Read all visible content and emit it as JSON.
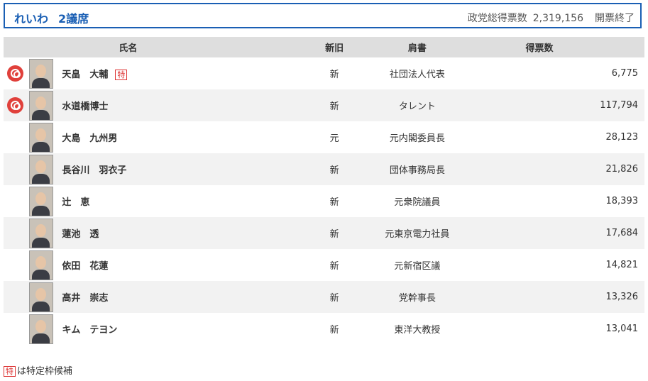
{
  "header": {
    "party": "れいわ",
    "seats": "2議席",
    "total_label": "政党総得票数",
    "total_votes": "2,319,156",
    "status": "開票終了"
  },
  "columns": {
    "name": "氏名",
    "new_old": "新旧",
    "title": "肩書",
    "votes": "得票数"
  },
  "badge_label": "特",
  "candidates": [
    {
      "name": "天畠　大輔",
      "new_old": "新",
      "title": "社団法人代表",
      "votes": "6,775",
      "elected": true,
      "special": true
    },
    {
      "name": "水道橋博士",
      "new_old": "新",
      "title": "タレント",
      "votes": "117,794",
      "elected": true,
      "special": false
    },
    {
      "name": "大島　九州男",
      "new_old": "元",
      "title": "元内閣委員長",
      "votes": "28,123",
      "elected": false,
      "special": false
    },
    {
      "name": "長谷川　羽衣子",
      "new_old": "新",
      "title": "団体事務局長",
      "votes": "21,826",
      "elected": false,
      "special": false
    },
    {
      "name": "辻　恵",
      "new_old": "新",
      "title": "元衆院議員",
      "votes": "18,393",
      "elected": false,
      "special": false
    },
    {
      "name": "蓮池　透",
      "new_old": "新",
      "title": "元東京電力社員",
      "votes": "17,684",
      "elected": false,
      "special": false
    },
    {
      "name": "依田　花蓮",
      "new_old": "新",
      "title": "元新宿区議",
      "votes": "14,821",
      "elected": false,
      "special": false
    },
    {
      "name": "高井　崇志",
      "new_old": "新",
      "title": "党幹事長",
      "votes": "13,326",
      "elected": false,
      "special": false
    },
    {
      "name": "キム　テヨン",
      "new_old": "新",
      "title": "東洋大教授",
      "votes": "13,041",
      "elected": false,
      "special": false
    }
  ],
  "footnote": {
    "badge": "特",
    "text": "は特定枠候補"
  },
  "colors": {
    "accent": "#1a5fb4",
    "elected_mark": "#e0403b",
    "special_badge": "#dd3333"
  }
}
